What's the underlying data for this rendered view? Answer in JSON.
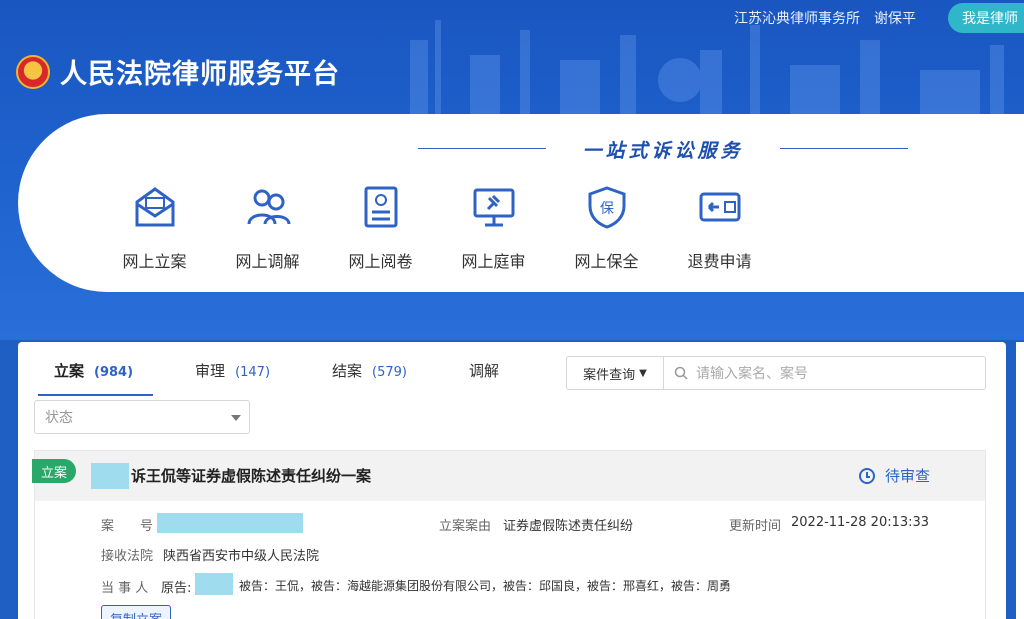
{
  "header": {
    "firm": "江苏沁典律师事务所",
    "user": "谢保平",
    "lawyer_button": "我是律师",
    "brand_title": "人民法院律师服务平台"
  },
  "service_panel": {
    "slogan": "一站式诉讼服务",
    "items": [
      {
        "label": "网上立案",
        "icon": "envelope-icon"
      },
      {
        "label": "网上调解",
        "icon": "people-icon"
      },
      {
        "label": "网上阅卷",
        "icon": "document-icon"
      },
      {
        "label": "网上庭审",
        "icon": "gavel-screen-icon"
      },
      {
        "label": "网上保全",
        "icon": "shield-icon"
      },
      {
        "label": "退费申请",
        "icon": "refund-card-icon"
      }
    ]
  },
  "case_list": {
    "tabs": [
      {
        "label": "立案",
        "count": "(984)"
      },
      {
        "label": "审理",
        "count": "(147)"
      },
      {
        "label": "结案",
        "count": "(579)"
      },
      {
        "label": "调解",
        "count": ""
      }
    ],
    "search": {
      "type_label": "案件查询",
      "placeholder": "请输入案名、案号"
    },
    "status_filter": {
      "placeholder": "状态"
    },
    "case": {
      "tag": "立案",
      "title": "诉王侃等证券虚假陈述责任纠纷一案",
      "status": "待审查",
      "case_no_label": "案　　号",
      "cause_label": "立案案由",
      "cause_value": "证券虚假陈述责任纠纷",
      "updated_label": "更新时间",
      "updated_value": "2022-11-28 20:13:33",
      "court_label": "接收法院",
      "court_value": "陕西省西安市中级人民法院",
      "parties_label": "当 事 人",
      "plaintiff_prefix": "原告:",
      "defendants": "被告：王侃，被告：海越能源集团股份有限公司，被告：邱国良，被告：邢喜红，被告：周勇",
      "copy_button": "复制立案"
    }
  },
  "colors": {
    "primary": "#2e63c5",
    "header_bg": "#1f5fc4",
    "tag_green": "#2aa86a",
    "redaction": "#9fdcee",
    "lawyer_btn": "#2fb7c9"
  }
}
